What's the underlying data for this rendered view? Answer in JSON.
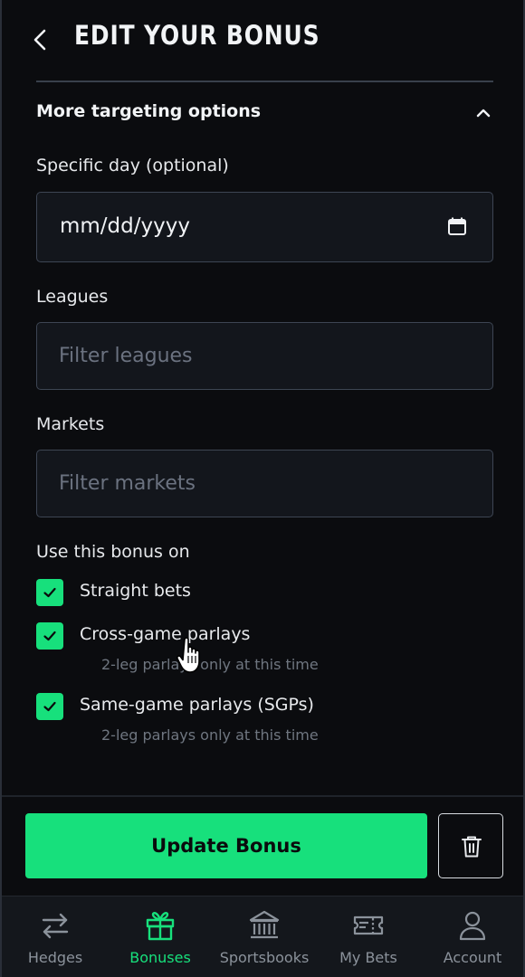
{
  "header": {
    "title": "EDIT YOUR BONUS",
    "back_icon": "chevron-left-icon"
  },
  "section": {
    "title": "More targeting options",
    "expanded": true,
    "toggle_icon": "chevron-up-icon"
  },
  "fields": {
    "specific_day": {
      "label": "Specific day (optional)",
      "value": "mm/dd/yyyy",
      "icon": "calendar-icon"
    },
    "leagues": {
      "label": "Leagues",
      "placeholder": "Filter leagues",
      "value": ""
    },
    "markets": {
      "label": "Markets",
      "placeholder": "Filter markets",
      "value": ""
    }
  },
  "use_on": {
    "label": "Use this bonus on",
    "options": [
      {
        "label": "Straight bets",
        "checked": true,
        "note": ""
      },
      {
        "label": "Cross-game parlays",
        "checked": true,
        "note": "2-leg parlays only at this time"
      },
      {
        "label": "Same-game parlays (SGPs)",
        "checked": true,
        "note": "2-leg parlays only at this time"
      }
    ]
  },
  "actions": {
    "update_label": "Update Bonus",
    "delete_icon": "trash-icon"
  },
  "bottom_nav": {
    "active": "Bonuses",
    "items": [
      {
        "label": "Hedges",
        "icon": "swap-arrows-icon"
      },
      {
        "label": "Bonuses",
        "icon": "gift-icon"
      },
      {
        "label": "Sportsbooks",
        "icon": "bank-icon"
      },
      {
        "label": "My Bets",
        "icon": "ticket-icon"
      },
      {
        "label": "Account",
        "icon": "user-icon"
      }
    ]
  },
  "colors": {
    "accent": "#17e07c",
    "background": "#0b0c0f",
    "input_background": "#13161c",
    "input_border": "#3d4553",
    "muted_text": "#6f7680"
  }
}
